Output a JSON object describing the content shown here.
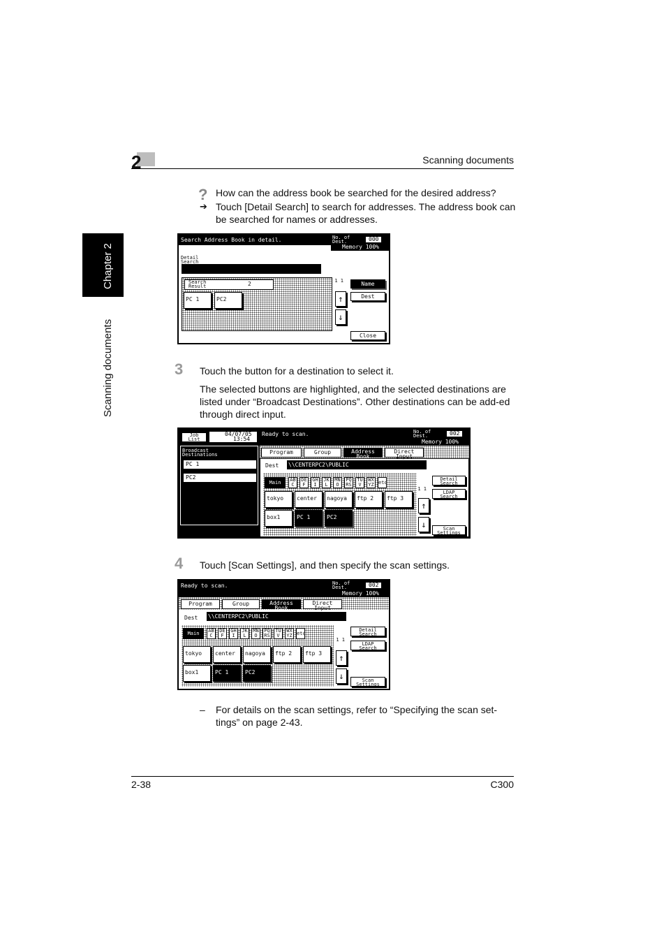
{
  "header": {
    "chapter_number": "2",
    "title": "Scanning documents"
  },
  "side_tab": {
    "chapter": "Chapter 2",
    "section": "Scanning documents"
  },
  "question": {
    "mark": "?",
    "text": "How can the address book be searched for the desired address?"
  },
  "answer": {
    "arrow": "➔",
    "text": "Touch [Detail Search] to search for addresses. The address book can be searched for names or addresses."
  },
  "step3": {
    "number": "3",
    "text": "Touch the button for a destination to select it.",
    "description": "The selected buttons are highlighted, and the selected destinations are listed under “Broadcast Destinations”. Other destinations can be add-ed through direct input."
  },
  "step4": {
    "number": "4",
    "text": "Touch [Scan Settings], and then specify the scan settings."
  },
  "note": {
    "dash": "–",
    "text": "For details on the scan settings, refer to “Specifying the scan set-tings” on page 2-43."
  },
  "footer": {
    "page": "2-38",
    "model": "C300"
  },
  "screen1": {
    "title": "Search Address Book in detail.",
    "no_of_dest_label": "No. of\nDest.",
    "no_of_dest_value": "000",
    "memory": "Memory 100%",
    "detail_search_label": "Detail\nSearch",
    "search_result_label": "Search\nResult",
    "search_result_value": "2",
    "page_indicator": "1\n1",
    "results": [
      "PC 1",
      "PC2"
    ],
    "buttons": {
      "name": "Name",
      "dest": "Dest",
      "close": "Close"
    },
    "up": "↑",
    "down": "↓"
  },
  "screen2": {
    "job_list": "Job\nList",
    "date": "04/07/05",
    "time": "13:54",
    "broadcast_label": "Broadcast\nDestinations",
    "broadcast_items": [
      "PC 1",
      "PC2"
    ],
    "title": "Ready to scan.",
    "no_of_dest_label": "No. of\nDest.",
    "no_of_dest_value": "002",
    "memory": "Memory 100%",
    "tabs": [
      "Program",
      "Group",
      "Address\nBook",
      "Direct\nInput"
    ],
    "dest_label": "Dest",
    "dest_value": "\\\\CENTERPC2\\PUBLIC",
    "alpha_tabs": [
      "Main",
      "AB\nC",
      "DE\nF",
      "GH\nI",
      "JK\nL",
      "MN\nO",
      "PQ\nRS",
      "TU\nV",
      "WX\nYZ",
      "etc"
    ],
    "page_indicator": "1\n1",
    "row1": [
      "tokyo",
      "center",
      "nagoya",
      "ftp 2",
      "ftp 3"
    ],
    "row2": [
      "box1",
      "PC 1",
      "PC2"
    ],
    "side_buttons": {
      "detail_search": "Detail\nSearch",
      "ldap_search": "LDAP\nSearch",
      "scan_settings": "Scan\nSettings"
    },
    "up": "↑",
    "down": "↓"
  },
  "screen3": {
    "title": "Ready to scan.",
    "no_of_dest_label": "No. of\nDest.",
    "no_of_dest_value": "002",
    "memory": "Memory 100%",
    "tabs": [
      "Program",
      "Group",
      "Address\nBook",
      "Direct\nInput"
    ],
    "dest_label": "Dest",
    "dest_value": "\\\\CENTERPC2\\PUBLIC",
    "alpha_tabs": [
      "Main",
      "AB\nC",
      "DE\nF",
      "GH\nI",
      "JK\nL",
      "MN\nO",
      "PQ\nRS",
      "TU\nV",
      "WX\nYZ",
      "etc"
    ],
    "page_indicator": "1\n1",
    "row1": [
      "tokyo",
      "center",
      "nagoya",
      "ftp 2",
      "ftp 3"
    ],
    "row2": [
      "box1",
      "PC 1",
      "PC2"
    ],
    "side_buttons": {
      "detail_search": "Detail\nSearch",
      "ldap_search": "LDAP\nSearch",
      "scan_settings": "Scan\nSettings"
    },
    "up": "↑",
    "down": "↓"
  }
}
